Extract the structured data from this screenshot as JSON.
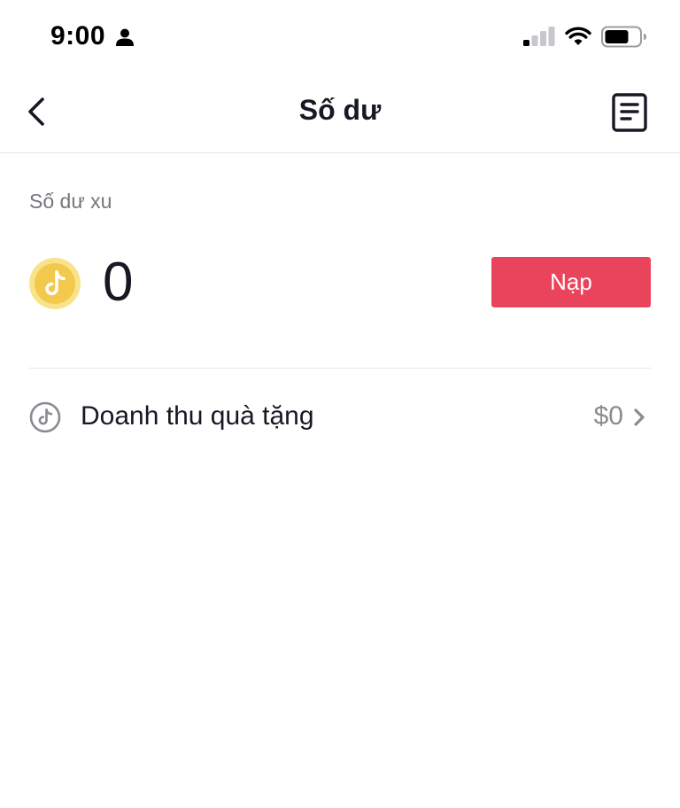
{
  "status_bar": {
    "time": "9:00",
    "icons": [
      "person-icon",
      "cellular-signal-icon",
      "wifi-icon",
      "battery-icon"
    ]
  },
  "nav": {
    "title": "Số dư",
    "back_icon": "chevron-left-icon",
    "history_icon": "document-icon"
  },
  "balance": {
    "label": "Số dư xu",
    "amount": "0",
    "recharge_label": "Nạp",
    "coin_icon": "tiktok-coin-icon"
  },
  "gift_revenue": {
    "label": "Doanh thu quà tặng",
    "value": "$0",
    "icon": "tiktok-circle-icon"
  },
  "colors": {
    "accent": "#ea445c",
    "coin": "#f7d84a",
    "text": "#161823",
    "secondary_text": "#75767c",
    "divider": "#e6e6e6"
  }
}
